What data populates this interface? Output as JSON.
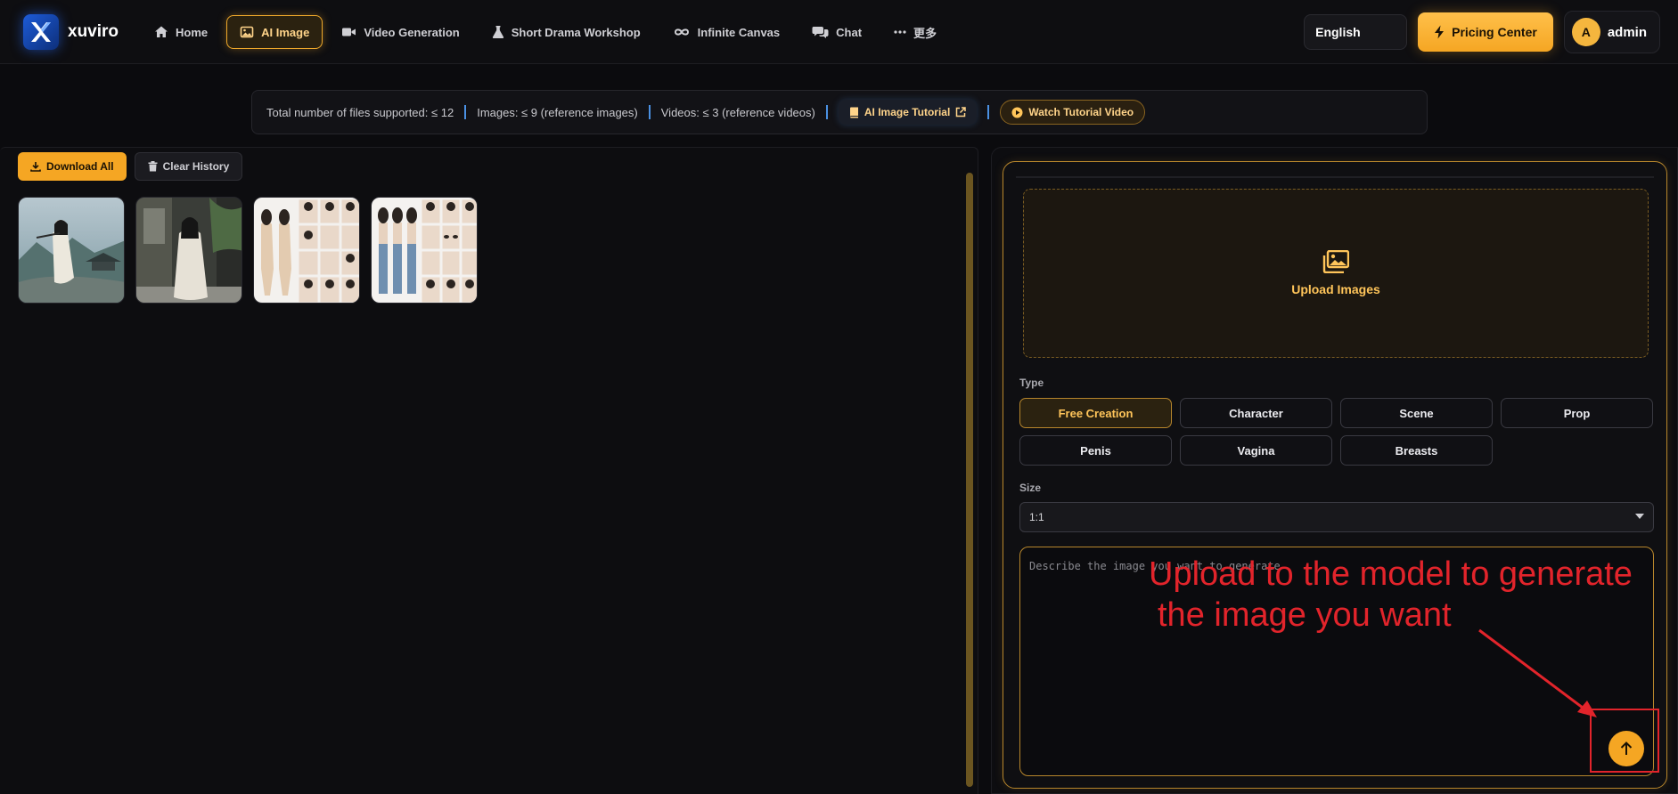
{
  "brand": {
    "name": "xuviro"
  },
  "nav": {
    "items": [
      {
        "label": "Home",
        "icon": "home-icon"
      },
      {
        "label": "AI Image",
        "icon": "image-icon",
        "active": true
      },
      {
        "label": "Video Generation",
        "icon": "video-icon"
      },
      {
        "label": "Short Drama Workshop",
        "icon": "flask-icon"
      },
      {
        "label": "Infinite Canvas",
        "icon": "infinity-icon"
      },
      {
        "label": "Chat",
        "icon": "chat-icon"
      },
      {
        "label": "更多",
        "icon": "more-icon"
      }
    ],
    "language": "English",
    "pricing_label": "Pricing Center",
    "user": {
      "initial": "A",
      "name": "admin"
    }
  },
  "infobar": {
    "total_files": "Total number of files supported: ≤ 12",
    "images": "Images: ≤ 9 (reference images)",
    "videos": "Videos: ≤ 3 (reference videos)",
    "tutorial_label": "AI Image Tutorial",
    "video_label": "Watch Tutorial Video"
  },
  "history": {
    "download_all_label": "Download All",
    "clear_label": "Clear History"
  },
  "generator": {
    "upload_label": "Upload Images",
    "type_label": "Type",
    "types": [
      "Free Creation",
      "Character",
      "Scene",
      "Prop",
      "Penis",
      "Vagina",
      "Breasts"
    ],
    "active_type": "Free Creation",
    "size_label": "Size",
    "size_value": "1:1",
    "prompt_placeholder": "Describe the image you want to generate"
  },
  "annotation": {
    "line1": "Upload to the model to generate",
    "line2": "the image you want"
  },
  "colors": {
    "accent": "#f5a623",
    "annotation": "#e2242b",
    "background": "#0b0b0e"
  }
}
